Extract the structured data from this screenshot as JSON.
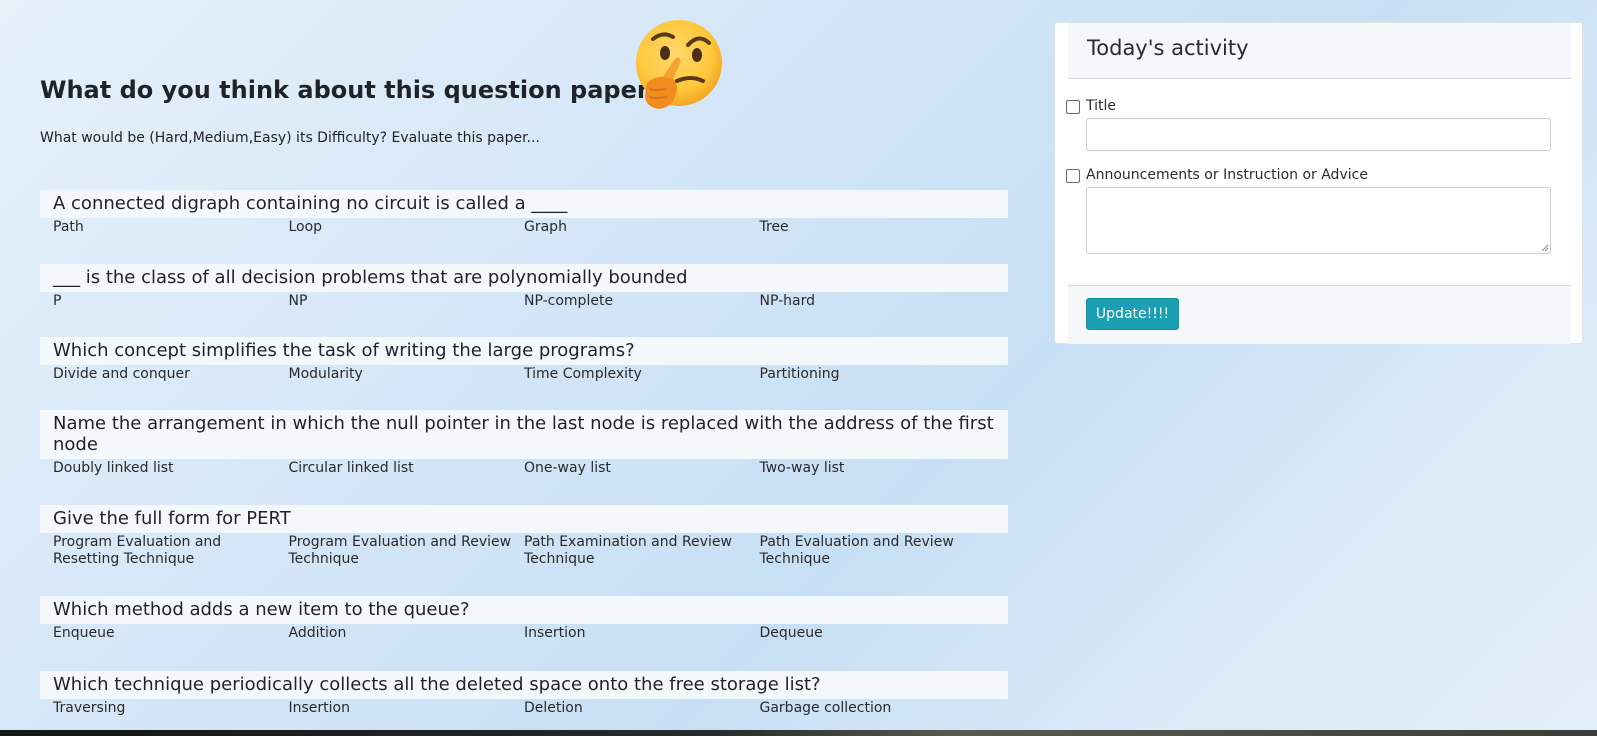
{
  "header": {
    "title": "What do you think about this question paper?",
    "subtitle": "What would be (Hard,Medium,Easy) its Difficulty? Evaluate this paper...",
    "emoji_icon": "thinking-face-emoji"
  },
  "questions": [
    {
      "text": "A connected digraph containing no circuit is called a ____",
      "options": [
        "Path",
        "Loop",
        "Graph",
        "Tree"
      ]
    },
    {
      "text": "___ is the class of all decision problems that are polynomially bounded",
      "options": [
        "P",
        "NP",
        "NP-complete",
        "NP-hard"
      ]
    },
    {
      "text": "Which concept simplifies the task of writing the large programs?",
      "options": [
        "Divide and conquer",
        "Modularity",
        "Time Complexity",
        "Partitioning"
      ]
    },
    {
      "text": "Name the arrangement in which the null pointer in the last node is replaced with the address of the first node",
      "options": [
        "Doubly linked list",
        "Circular linked list",
        "One-way list",
        "Two-way list"
      ]
    },
    {
      "text": "Give the full form for PERT",
      "options": [
        "Program Evaluation and Resetting Technique",
        "Program Evaluation and Review Technique",
        "Path Examination and Review Technique",
        "Path Evaluation and Review Technique"
      ]
    },
    {
      "text": "Which method adds a new item to the queue?",
      "options": [
        "Enqueue",
        "Addition",
        "Insertion",
        "Dequeue"
      ]
    },
    {
      "text": "Which technique periodically collects all the deleted space onto the free storage list?",
      "options": [
        "Traversing",
        "Insertion",
        "Deletion",
        "Garbage collection"
      ]
    }
  ],
  "activity": {
    "title": "Today's activity",
    "title_label": "Title",
    "title_value": "",
    "announcement_label": "Announcements or Instruction or Advice",
    "announcement_value": "",
    "update_label": "Update!!!!",
    "button_color": "#1a9fb3"
  }
}
